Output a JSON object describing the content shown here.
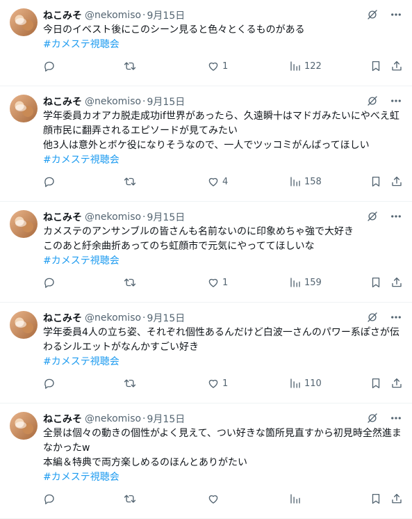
{
  "colors": {
    "hashtag": "#1d9bf0",
    "muted": "#536471",
    "text": "#0f1419",
    "divider": "#eff3f4"
  },
  "tweets": [
    {
      "name": "ねこみそ",
      "handle": "@nekomiso",
      "dot": "·",
      "time": "9月15日",
      "lines": [
        "今日のイベスト後にこのシーン見ると色々とくるものがある"
      ],
      "hashtag": "#カメステ視聴会",
      "replies": "",
      "retweets": "",
      "likes": "1",
      "views": "122"
    },
    {
      "name": "ねこみそ",
      "handle": "@nekomiso",
      "dot": "·",
      "time": "9月15日",
      "lines": [
        "学年委員カオアカ脱走成功if世界があったら、久遠瞬十はマドガみたいにやべえ虹",
        "顔市民に翻弄されるエピソードが見てみたい",
        "他3人は意外とボケ役になりそうなので、一人でツッコミがんばってほしい"
      ],
      "hashtag": "#カメステ視聴会",
      "replies": "",
      "retweets": "",
      "likes": "4",
      "views": "158"
    },
    {
      "name": "ねこみそ",
      "handle": "@nekomiso",
      "dot": "·",
      "time": "9月15日",
      "lines": [
        "カメステのアンサンブルの皆さんも名前ないのに印象めちゃ強で大好き",
        "このあと紆余曲折あってのち虹顔市で元気にやっててほしいな"
      ],
      "hashtag": "#カメステ視聴会",
      "replies": "",
      "retweets": "",
      "likes": "1",
      "views": "159"
    },
    {
      "name": "ねこみそ",
      "handle": "@nekomiso",
      "dot": "·",
      "time": "9月15日",
      "lines": [
        "学年委員4人の立ち姿、それぞれ個性あるんだけど白波一さんのパワー系ぽさが伝",
        "わるシルエットがなんかすごい好き"
      ],
      "hashtag": "#カメステ視聴会",
      "replies": "",
      "retweets": "",
      "likes": "1",
      "views": "110"
    },
    {
      "name": "ねこみそ",
      "handle": "@nekomiso",
      "dot": "·",
      "time": "9月15日",
      "lines": [
        "全景は個々の動きの個性がよく見えて、つい好きな箇所見直すから初見時全然進ま",
        "なかったw",
        "本編＆特典で両方楽しめるのほんとありがたい"
      ],
      "hashtag": "#カメステ視聴会",
      "replies": "",
      "retweets": "",
      "likes": "",
      "views": ""
    }
  ],
  "icons": {
    "grok": "grok-icon",
    "more": "more-icon",
    "reply": "reply-icon",
    "retweet": "retweet-icon",
    "like": "like-icon",
    "views": "views-icon",
    "bookmark": "bookmark-icon",
    "share": "share-icon"
  }
}
